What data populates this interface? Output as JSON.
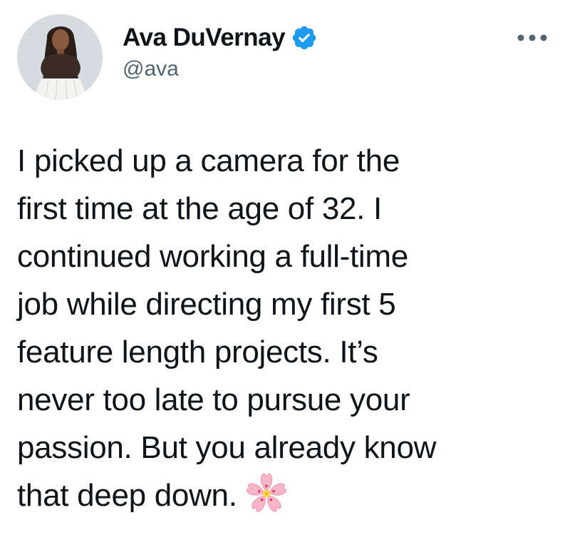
{
  "author": {
    "display_name": "Ava DuVernay",
    "handle": "@ava",
    "verified": true,
    "avatar_icon": "profile-photo"
  },
  "menu": {
    "more_icon": "more-horizontal-icon"
  },
  "tweet": {
    "lines": [
      "I picked up a camera for the",
      "first time at the age of 32. I",
      "continued working a full-time",
      "job while directing my first 5",
      "feature length projects. It’s",
      "never too late to pursue your",
      "passion. But you already know",
      "that deep down."
    ],
    "emoji": "cherry-blossom-icon"
  },
  "colors": {
    "verified_blue": "#1d9bf0",
    "text": "#0f1419",
    "secondary_text": "#536471",
    "blossom_pink": "#f7b6c8"
  }
}
